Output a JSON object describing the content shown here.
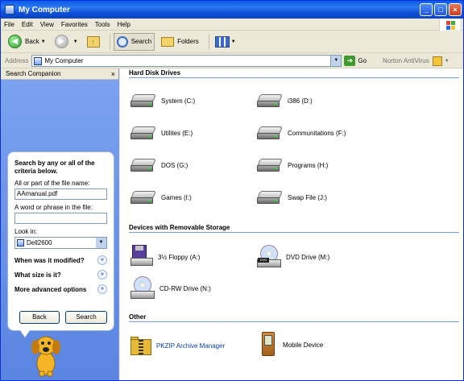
{
  "window": {
    "title": "My Computer"
  },
  "menu": [
    "File",
    "Edit",
    "View",
    "Favorites",
    "Tools",
    "Help"
  ],
  "toolbar": {
    "back": "Back",
    "search": "Search",
    "folders": "Folders"
  },
  "address": {
    "label": "Address",
    "value": "My Computer",
    "go": "Go",
    "norton": "Norton AntiVirus"
  },
  "sidebar": {
    "title": "Search Companion",
    "heading": "Search by any or all of the criteria below.",
    "filename_label": "All or part of the file name:",
    "filename_value": "AAmanual.pdf",
    "phrase_label": "A word or phrase in the file:",
    "phrase_value": "",
    "lookin_label": "Look in:",
    "lookin_value": "Dell2600",
    "options": [
      "When was it modified?",
      "What size is it?",
      "More advanced options"
    ],
    "back_btn": "Back",
    "search_btn": "Search"
  },
  "groups": {
    "hdd": {
      "title": "Hard Disk Drives",
      "items": [
        "System (C:)",
        "i386 (D:)",
        "Utilites (E:)",
        "Communitations (F:)",
        "DOS (G:)",
        "Programs (H:)",
        "Games (I:)",
        "Swap File (J:)"
      ]
    },
    "removable": {
      "title": "Devices with Removable Storage",
      "items": [
        "3½ Floppy (A:)",
        "DVD Drive (M:)",
        "CD-RW Drive (N:)"
      ]
    },
    "other": {
      "title": "Other",
      "items": [
        "PKZIP Archive Manager",
        "Mobile Device"
      ]
    }
  },
  "colors": {
    "titlebar": "#0a5ce8",
    "sidebar": "#6d96e8",
    "link": "#0a3fa8"
  }
}
